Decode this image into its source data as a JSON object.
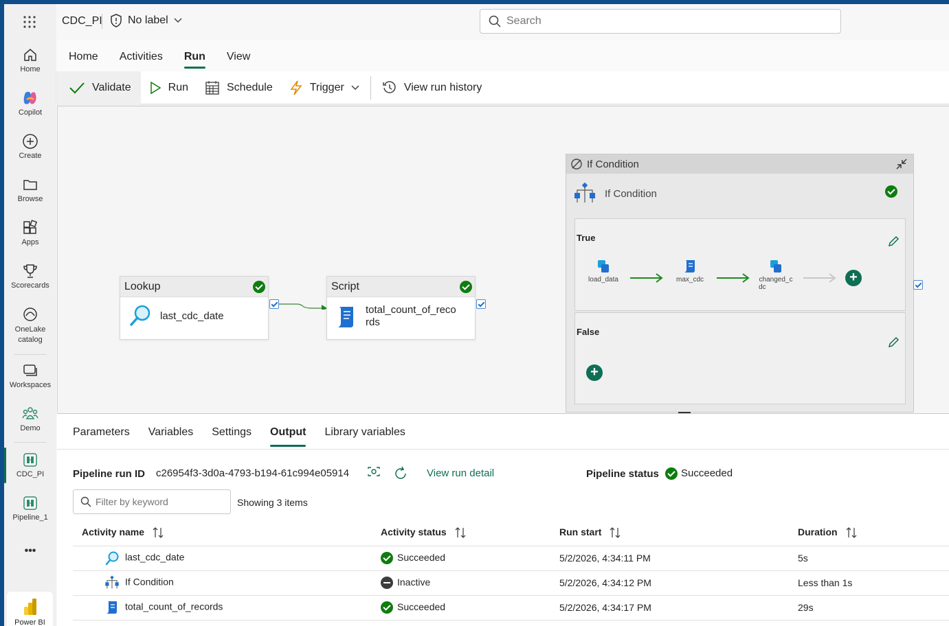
{
  "header": {
    "workspace_title": "CDC_PI",
    "label_text": "No label",
    "search_placeholder": "Search"
  },
  "rail": {
    "items": [
      {
        "label": "Home",
        "icon": "home-icon"
      },
      {
        "label": "Copilot",
        "icon": "copilot-icon"
      },
      {
        "label": "Create",
        "icon": "plus-circle-icon"
      },
      {
        "label": "Browse",
        "icon": "folder-icon"
      },
      {
        "label": "Apps",
        "icon": "apps-icon"
      },
      {
        "label": "Scorecards",
        "icon": "trophy-icon"
      },
      {
        "label": "OneLake catalog",
        "icon": "onelake-icon"
      },
      {
        "label": "Workspaces",
        "icon": "workspaces-icon"
      },
      {
        "label": "Demo",
        "icon": "people-icon"
      },
      {
        "label": "CDC_PI",
        "icon": "pipeline-icon"
      },
      {
        "label": "Pipeline_1",
        "icon": "pipeline-icon"
      }
    ],
    "more": "•••",
    "powerbi_label": "Power BI"
  },
  "ribbon": {
    "tabs": [
      "Home",
      "Activities",
      "Run",
      "View"
    ],
    "active_tab": "Run",
    "buttons": {
      "validate": "Validate",
      "run": "Run",
      "schedule": "Schedule",
      "trigger": "Trigger",
      "history": "View run history"
    }
  },
  "canvas": {
    "lookup": {
      "type": "Lookup",
      "name": "last_cdc_date"
    },
    "script": {
      "type": "Script",
      "name_line1": "total_count_of_reco",
      "name_line2": "rds"
    },
    "ifcond": {
      "header": "If Condition",
      "name": "If Condition",
      "true_label": "True",
      "false_label": "False",
      "true_activities": [
        "load_data",
        "max_cdc",
        "changed_c",
        "dc"
      ]
    }
  },
  "panel": {
    "tabs": [
      "Parameters",
      "Variables",
      "Settings",
      "Output",
      "Library variables"
    ],
    "active_tab": "Output",
    "run_id_label": "Pipeline run ID",
    "run_id": "c26954f3-3d0a-4793-b194-61c994e05914",
    "view_run_detail": "View run detail",
    "status_label": "Pipeline status",
    "status_value": "Succeeded",
    "filter_placeholder": "Filter by keyword",
    "showing": "Showing 3 items",
    "columns": [
      "Activity name",
      "Activity status",
      "Run start",
      "Duration"
    ],
    "rows": [
      {
        "name": "last_cdc_date",
        "icon": "lookup-icon",
        "status": "Succeeded",
        "start": "5/2/2026, 4:34:11 PM",
        "duration": "5s"
      },
      {
        "name": "If Condition",
        "icon": "if-condition-icon",
        "status": "Inactive",
        "start": "5/2/2026, 4:34:12 PM",
        "duration": "Less than 1s"
      },
      {
        "name": "total_count_of_records",
        "icon": "script-icon",
        "status": "Succeeded",
        "start": "5/2/2026, 4:34:17 PM",
        "duration": "29s"
      }
    ]
  },
  "colors": {
    "accent": "#0f6e55",
    "success": "#107c10",
    "link": "#0f6e55"
  }
}
